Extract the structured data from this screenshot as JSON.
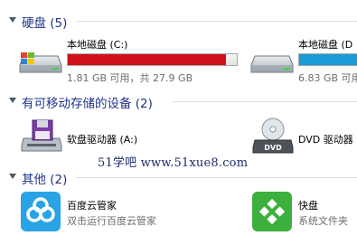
{
  "sections": [
    {
      "title": "硬盘 (5)"
    },
    {
      "title": "有可移动存储的设备 (2)"
    },
    {
      "title": "其他 (2)"
    }
  ],
  "drives": [
    {
      "name": "本地磁盘 (C:)",
      "space": "1.81 GB 可用，共 27.9 GB",
      "used_fraction": 0.935,
      "bar_color": "#d0111a",
      "icon": "windows-drive-icon"
    },
    {
      "name": "本地磁盘 (D",
      "space": "6.83 GB 可用",
      "used_fraction": 0.75,
      "bar_color": "#1a9ad6",
      "icon": "hard-drive-icon"
    }
  ],
  "removable": [
    {
      "name": "软盘驱动器 (A:)",
      "icon": "floppy-drive-icon"
    },
    {
      "name": "DVD 驱动器",
      "icon": "dvd-drive-icon",
      "badge": "DVD"
    }
  ],
  "others": [
    {
      "name": "百度云管家",
      "desc": "双击运行百度云管家",
      "icon": "baidu-cloud-icon",
      "color": "#2aa3e6"
    },
    {
      "name": "快盘",
      "desc": "系统文件夹",
      "icon": "kuaipan-icon",
      "color": "#3cb03c"
    }
  ],
  "watermark": "51学吧 www.51xue8.com"
}
